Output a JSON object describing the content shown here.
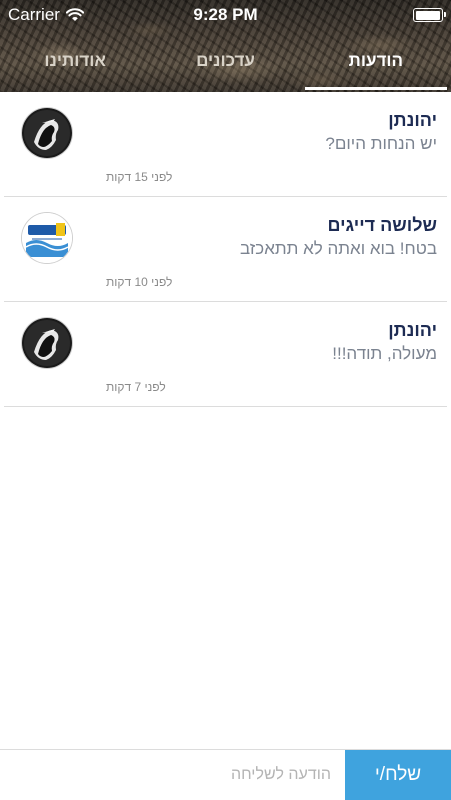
{
  "status_bar": {
    "carrier": "Carrier",
    "time": "9:28 PM",
    "battery_level": 1.0
  },
  "tabs": [
    {
      "label": "הודעות",
      "active": true
    },
    {
      "label": "עדכונים",
      "active": false
    },
    {
      "label": "אודותינו",
      "active": false
    }
  ],
  "messages": [
    {
      "name": "יהונתן",
      "text": "יש הנחות היום?",
      "time": "לפני 15 דקות",
      "avatar": "dark-figure-avatar"
    },
    {
      "name": "שלושה דייגים",
      "text": "בטח! בוא ואתה לא תתאכזב",
      "time": "לפני 10 דקות",
      "avatar": "fishermen-logo-avatar"
    },
    {
      "name": "יהונתן",
      "text": "מעולה, תודה!!!",
      "time": "לפני 7 דקות",
      "avatar": "dark-figure-avatar"
    }
  ],
  "compose": {
    "placeholder": "הודעה לשליחה",
    "send_label": "שלח/י"
  },
  "colors": {
    "accent": "#3fa3de",
    "name_text": "#1d2b53",
    "message_text": "#7b8390"
  }
}
